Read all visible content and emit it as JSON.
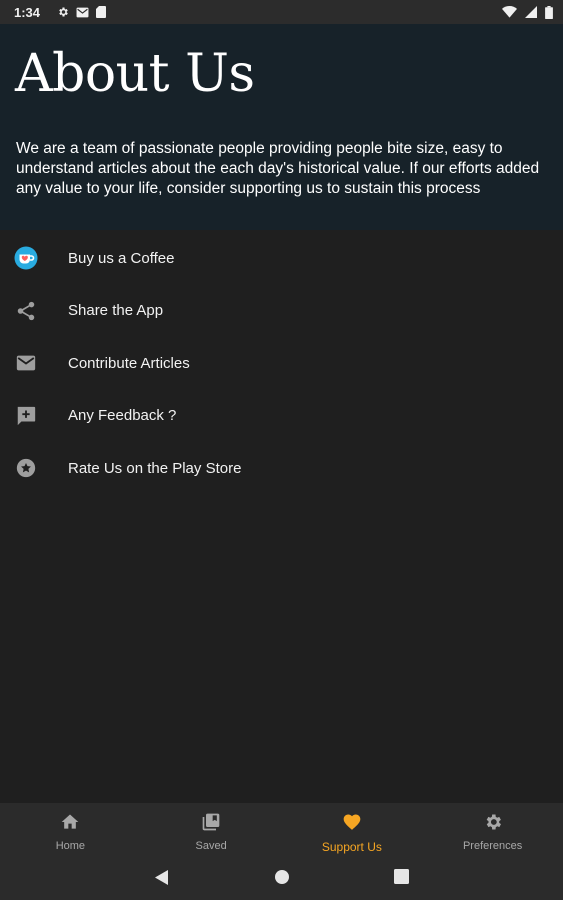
{
  "status_bar": {
    "time": "1:34",
    "left_icons": [
      "settings-icon",
      "gmail-icon",
      "sd-card-icon"
    ],
    "right_icons": [
      "wifi-icon",
      "cellular-icon",
      "battery-icon"
    ]
  },
  "header": {
    "title": "About Us",
    "intro": "We are a team of passionate people providing people bite size, easy to understand articles about the each day's historical value. If our efforts added any value to your life, consider supporting us to sustain this process",
    "background": "#172229"
  },
  "menu": {
    "items": [
      {
        "label": "Buy us a Coffee",
        "icon": "coffee-cup-icon"
      },
      {
        "label": "Share the App",
        "icon": "share-icon"
      },
      {
        "label": "Contribute Articles",
        "icon": "email-icon"
      },
      {
        "label": "Any Feedback ?",
        "icon": "feedback-icon"
      },
      {
        "label": "Rate Us on the Play Store",
        "icon": "star-icon"
      }
    ]
  },
  "bottom_nav": {
    "items": [
      {
        "label": "Home",
        "icon": "home-icon",
        "active": false
      },
      {
        "label": "Saved",
        "icon": "saved-icon",
        "active": false
      },
      {
        "label": "Support Us",
        "icon": "heart-icon",
        "active": true
      },
      {
        "label": "Preferences",
        "icon": "gear-icon",
        "active": false
      }
    ],
    "accent": "#f6a623"
  },
  "system_nav": {
    "buttons": [
      "back-icon",
      "home-circle-icon",
      "recents-icon"
    ]
  }
}
